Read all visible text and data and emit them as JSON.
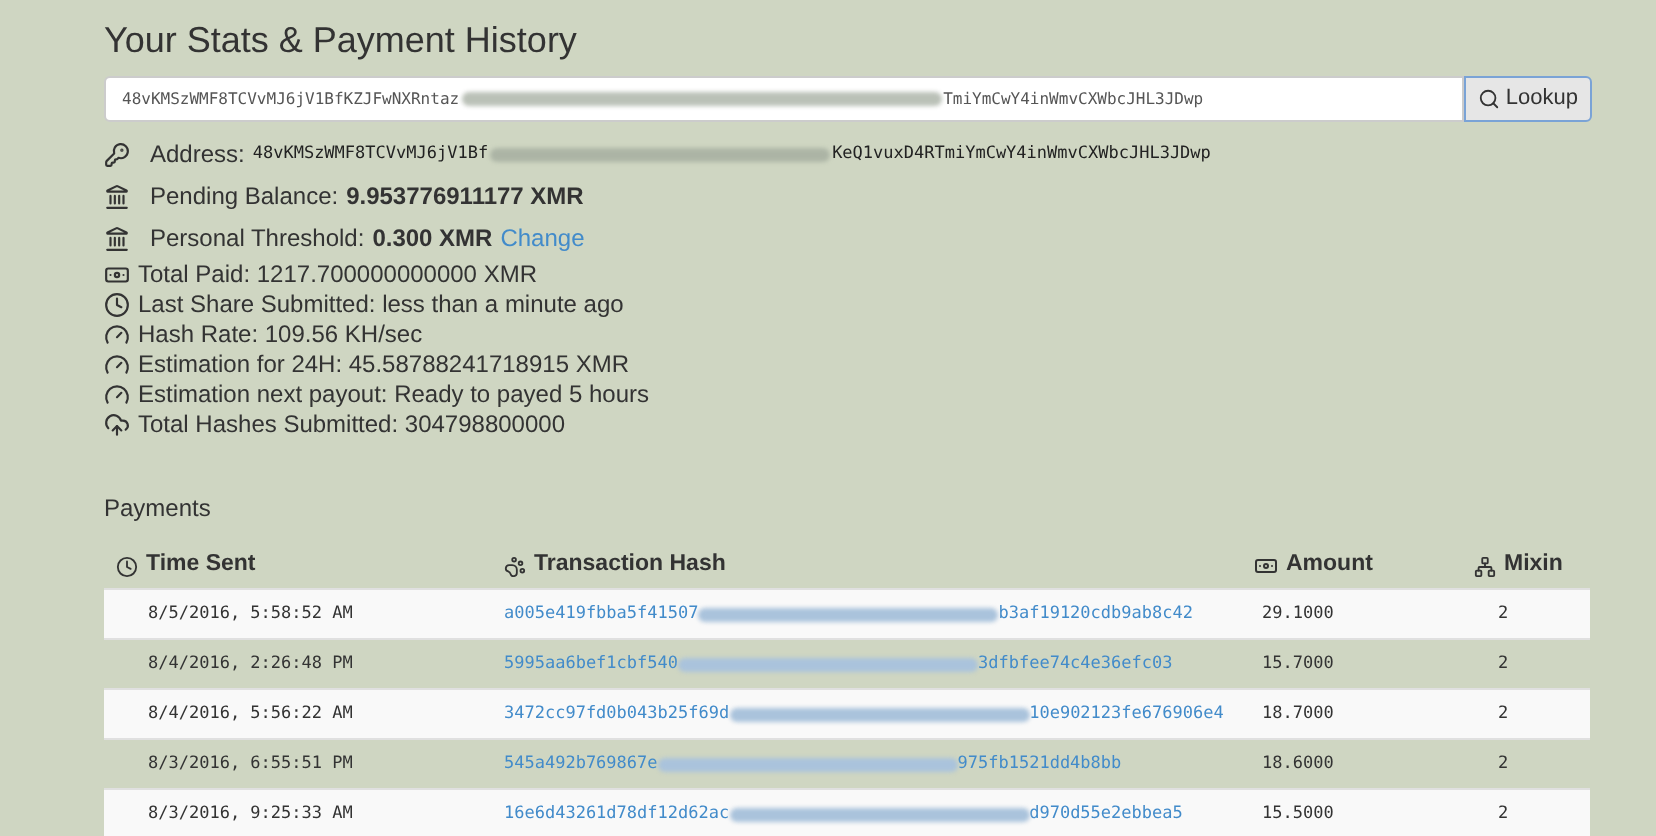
{
  "title": "Your Stats & Payment History",
  "lookup": {
    "value_start": "48vKMSzWMF8TCVvMJ6jV1BfKZJFwNXRntaz",
    "value_end": "TmiYmCwY4inWmvCXWbcJHL3JDwp",
    "button": "Lookup"
  },
  "stats": [
    {
      "kind": "address",
      "label": "Address:",
      "value_start": "48vKMSzWMF8TCVvMJ6jV1Bf",
      "value_end": "KeQ1vuxD4RTmiYmCwY4inWmvCXWbcJHL3JDwp"
    },
    {
      "kind": "balance",
      "label": "Pending Balance:",
      "value": "9.953776911177 XMR"
    },
    {
      "kind": "threshold",
      "label": "Personal Threshold:",
      "value": "0.300 XMR",
      "link": "Change"
    },
    {
      "kind": "paid",
      "text": "Total Paid: 1217.700000000000 XMR"
    },
    {
      "kind": "clock",
      "text": "Last Share Submitted: less than a minute ago"
    },
    {
      "kind": "gauge",
      "text": "Hash Rate: 109.56 KH/sec"
    },
    {
      "kind": "gauge",
      "text": "Estimation for 24H: 45.58788241718915 XMR"
    },
    {
      "kind": "gauge",
      "text": "Estimation next payout: Ready to payed 5 hours"
    },
    {
      "kind": "cloud",
      "text": "Total Hashes Submitted: 304798800000"
    }
  ],
  "payments": {
    "title": "Payments",
    "columns": [
      "Time Sent",
      "Transaction Hash",
      "Amount",
      "Mixin"
    ],
    "rows": [
      {
        "time": "8/5/2016, 5:58:52 AM",
        "hash_start": "a005e419fbba5f41507",
        "hash_end": "b3af19120cdb9ab8c42",
        "amount": "29.1000",
        "mixin": "2"
      },
      {
        "time": "8/4/2016, 2:26:48 PM",
        "hash_start": "5995aa6bef1cbf540",
        "hash_end": "3dfbfee74c4e36efc03",
        "amount": "15.7000",
        "mixin": "2"
      },
      {
        "time": "8/4/2016, 5:56:22 AM",
        "hash_start": "3472cc97fd0b043b25f69d",
        "hash_end": "10e902123fe676906e4",
        "amount": "18.7000",
        "mixin": "2"
      },
      {
        "time": "8/3/2016, 6:55:51 PM",
        "hash_start": "545a492b769867e",
        "hash_end": "975fb1521dd4b8bb",
        "amount": "18.6000",
        "mixin": "2"
      },
      {
        "time": "8/3/2016, 9:25:33 AM",
        "hash_start": "16e6d43261d78df12d62ac",
        "hash_end": "d970d55e2ebbea5",
        "amount": "15.5000",
        "mixin": "2"
      }
    ]
  }
}
